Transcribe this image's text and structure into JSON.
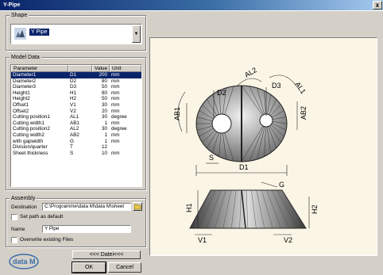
{
  "window": {
    "title": "Y-Pipe",
    "close_label": "x"
  },
  "shape": {
    "legend": "Shape",
    "selected": "Y Pipe",
    "thumb_icon": "y-pipe-thumbnail-icon"
  },
  "model_data": {
    "legend": "Model Data",
    "columns": [
      "Parameter",
      "",
      "Value",
      "Unit"
    ],
    "rows": [
      {
        "param": "Diameter1",
        "sym": "D1",
        "value": "200",
        "unit": "mm"
      },
      {
        "param": "Diameter2",
        "sym": "D2",
        "value": "80",
        "unit": "mm"
      },
      {
        "param": "Diameter3",
        "sym": "D3",
        "value": "50",
        "unit": "mm"
      },
      {
        "param": "Height1",
        "sym": "H1",
        "value": "80",
        "unit": "mm"
      },
      {
        "param": "Height2",
        "sym": "H2",
        "value": "50",
        "unit": "mm"
      },
      {
        "param": "Offset1",
        "sym": "V1",
        "value": "30",
        "unit": "mm"
      },
      {
        "param": "Offset2",
        "sym": "V2",
        "value": "20",
        "unit": "mm"
      },
      {
        "param": "Cutting position1",
        "sym": "AL1",
        "value": "30",
        "unit": "degree"
      },
      {
        "param": "Cutting width1",
        "sym": "AB1",
        "value": "1",
        "unit": "mm"
      },
      {
        "param": "Cutting position2",
        "sym": "AL2",
        "value": "30",
        "unit": "degree"
      },
      {
        "param": "Cutting width2",
        "sym": "AB2",
        "value": "1",
        "unit": "mm"
      },
      {
        "param": "with gapwidth",
        "sym": "G",
        "value": "1",
        "unit": "mm"
      },
      {
        "param": "Division/quarter",
        "sym": "T",
        "value": "12",
        "unit": ""
      },
      {
        "param": "Sheet thickness",
        "sym": "S",
        "value": "10",
        "unit": "mm"
      }
    ],
    "selected_row": 0
  },
  "assembly": {
    "legend": "Assembly",
    "destination_label": "Destination",
    "destination_value": "C:\\Programme\\data M\\data M\\sheet",
    "set_default_label": "Set path as default",
    "name_label": "Name",
    "name_value": "Y Pipe",
    "overwrite_label": "Overwrite existing Files",
    "browse_icon": "folder-browse-icon"
  },
  "logo_text": "data M",
  "buttons": {
    "nav": "<<< Datei<<<",
    "ok": "OK",
    "cancel": "Cancel"
  },
  "drawing": {
    "labels": [
      "AL2",
      "AL1",
      "D2",
      "D3",
      "AB1",
      "AB2",
      "S",
      "D1",
      "G",
      "H1",
      "H2",
      "V1",
      "V2"
    ],
    "background": "#fbf5e6"
  }
}
